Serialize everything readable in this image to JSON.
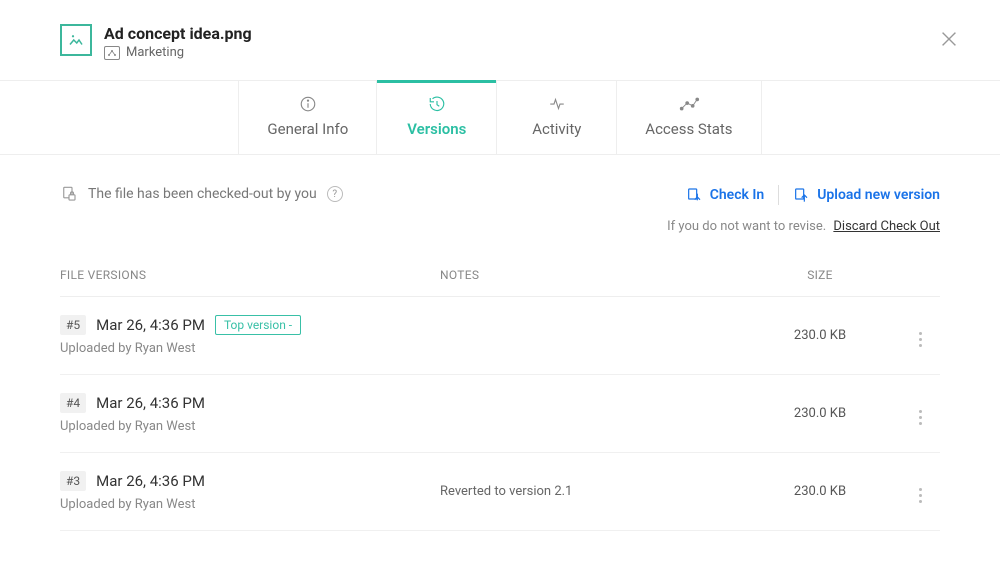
{
  "file": {
    "name": "Ad concept idea.png",
    "location": "Marketing"
  },
  "tabs": {
    "general": "General Info",
    "versions": "Versions",
    "activity": "Activity",
    "access": "Access Stats"
  },
  "status": {
    "checkout_text": "The file has been checked-out by you"
  },
  "actions": {
    "check_in": "Check In",
    "upload_new": "Upload new version",
    "discard_prefix": "If you do not want to revise.",
    "discard_link": "Discard Check Out"
  },
  "columns": {
    "versions": "FILE VERSIONS",
    "notes": "NOTES",
    "size": "SIZE"
  },
  "uploaded_by_prefix": "Uploaded by ",
  "top_version_label": "Top version -",
  "versions": [
    {
      "num": "#5",
      "date": "Mar 26, 4:36 PM",
      "uploader": "Ryan West",
      "notes": "",
      "size": "230.0 KB",
      "is_top": true
    },
    {
      "num": "#4",
      "date": "Mar 26, 4:36 PM",
      "uploader": "Ryan West",
      "notes": "",
      "size": "230.0 KB",
      "is_top": false
    },
    {
      "num": "#3",
      "date": "Mar 26, 4:36 PM",
      "uploader": "Ryan West",
      "notes": "Reverted to version 2.1",
      "size": "230.0 KB",
      "is_top": false
    }
  ]
}
